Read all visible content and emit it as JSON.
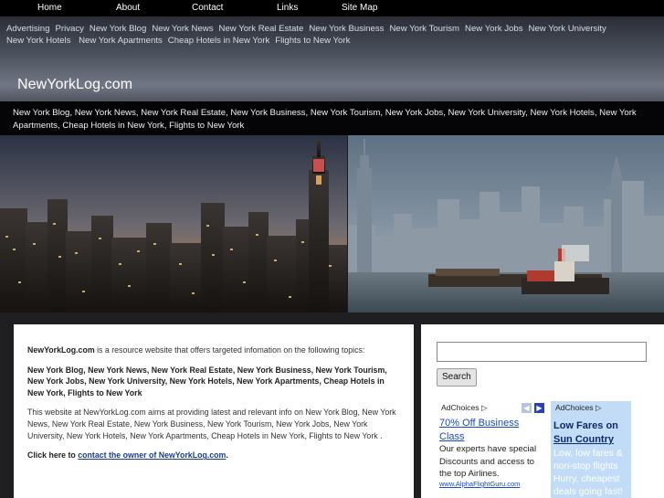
{
  "nav": {
    "items": [
      "Home",
      "About",
      "Contact",
      "Links",
      "Site Map"
    ]
  },
  "header": {
    "category_links": [
      "Advertising",
      "Privacy",
      "New York Blog",
      "New York News",
      "New York Real Estate",
      "New York Business",
      "New York Tourism",
      "New York Jobs",
      "New York University",
      "New York Hotels",
      "New York Apartments",
      "Cheap Hotels in New York",
      "Flights to New York"
    ],
    "site_title": "NewYorkLog.com",
    "tagline": "New York Blog, New York News, New York Real Estate, New York Business, New York Tourism, New York Jobs, New York University, New York Hotels, New York Apartments, Cheap Hotels in New York, Flights to New York"
  },
  "content": {
    "intro_site": "NewYorkLog.com",
    "intro_rest": " is a resource website that offers targeted infomation on the following topics:",
    "topics": "New York Blog, New York News, New York Real Estate, New York Business, New York Tourism, New York Jobs, New York University, New York Hotels, New York Apartments, Cheap Hotels in New York, Flights to New York",
    "description": "This website at NewYorkLog.com aims at providing latest and relevant info on New York Blog, New York News, New York Real Estate, New York Business, New York Tourism, New York Jobs, New York University, New York Hotels, New York Apartments, Cheap Hotels in New York, Flights to New York .",
    "click_prefix": "Click here to ",
    "owner_link": "contact the owner of NewYorkLog.com",
    "click_suffix": "."
  },
  "sidebar": {
    "search_placeholder": "",
    "search_button": "Search",
    "ad1": {
      "adchoices": "AdChoices",
      "title": "70% Off Business Class",
      "body": "Our experts have special Discounts and access to the top Airlines.",
      "url": "www.AlphaFlightGuru.com"
    },
    "ad2": {
      "adchoices": "AdChoices",
      "title_line1": "Low Fares on",
      "title_link": "Sun Country",
      "body": "Low, low fares & non-stop flights Hurry, cheapest deals going fast!"
    }
  },
  "colors": {
    "link_blue": "#1a4bc2",
    "ad_panel_blue": "#c2dcf7"
  }
}
